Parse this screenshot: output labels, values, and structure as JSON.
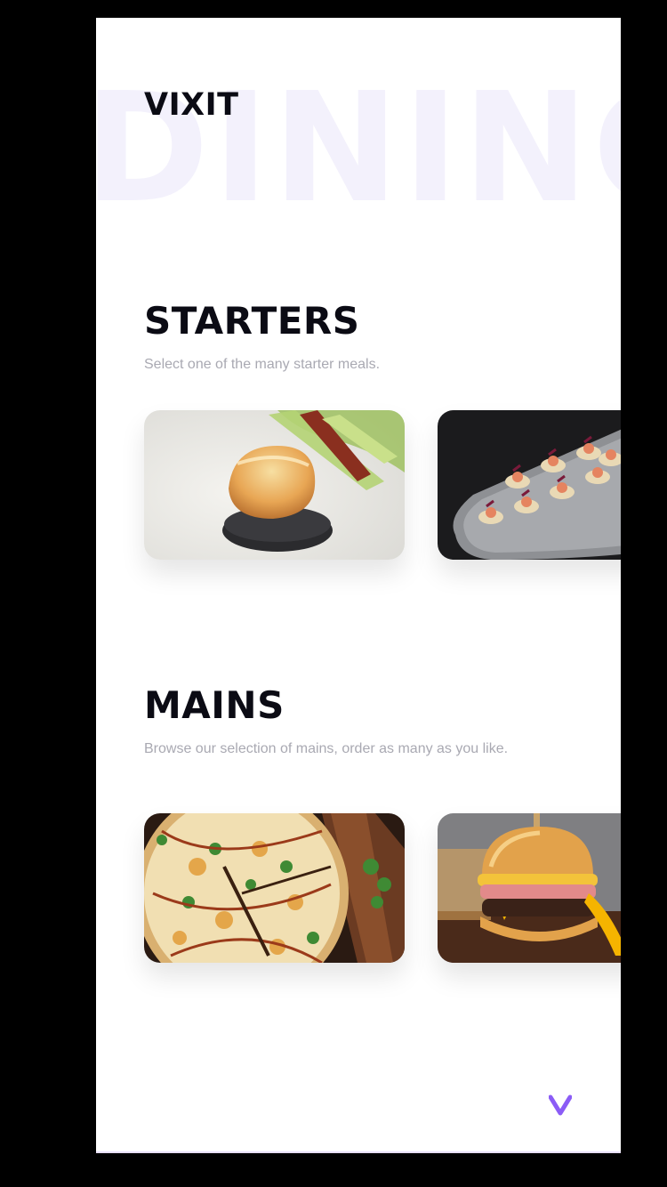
{
  "background_word": "DINING",
  "brand": {
    "name": "VIXIT"
  },
  "sections": [
    {
      "title": "STARTERS",
      "subtitle": "Select one of the many starter meals.",
      "items": [
        {
          "image": "seared-scallop-plate-image"
        },
        {
          "image": "canape-platter-image"
        }
      ]
    },
    {
      "title": "MAINS",
      "subtitle": "Browse our selection of mains, order as many as you like.",
      "items": [
        {
          "image": "pizza-board-image"
        },
        {
          "image": "burger-image"
        }
      ]
    }
  ],
  "colors": {
    "accent": "#8b5cf6",
    "background_word": "#f3f1fc",
    "title": "#0b0b14",
    "subtitle": "#a9a9b2"
  },
  "icons": {
    "logo": "v-logo-icon"
  }
}
